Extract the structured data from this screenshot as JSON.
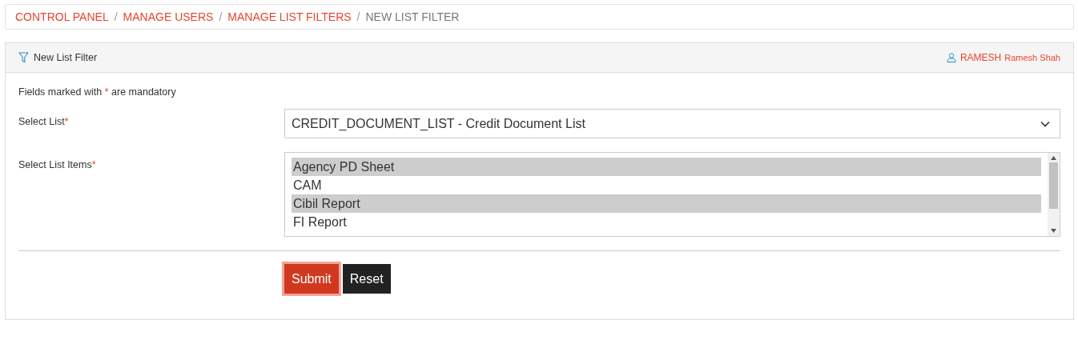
{
  "breadcrumb": [
    {
      "label": "CONTROL PANEL",
      "link": true
    },
    {
      "label": "MANAGE USERS",
      "link": true
    },
    {
      "label": "MANAGE LIST FILTERS",
      "link": true
    },
    {
      "label": "NEW LIST FILTER",
      "link": false
    }
  ],
  "breadcrumb_separator": "/",
  "panel": {
    "title": "New List Filter",
    "user_code": "RAMESH",
    "user_name": "Ramesh Shah"
  },
  "mandatory_note": {
    "before": "Fields marked with",
    "mark": "*",
    "after": "are mandatory"
  },
  "fields": [
    {
      "kind": "select",
      "label": "Select List",
      "required": true,
      "value": "CREDIT_DOCUMENT_LIST - Credit Document List"
    },
    {
      "kind": "listbox",
      "label": "Select List Items",
      "required": true,
      "options": [
        {
          "label": "Agency PD Sheet",
          "selected": true
        },
        {
          "label": "CAM",
          "selected": false
        },
        {
          "label": "Cibil Report",
          "selected": true
        },
        {
          "label": "FI Report",
          "selected": false
        }
      ]
    }
  ],
  "buttons": [
    {
      "kind": "primary",
      "label": "Submit"
    },
    {
      "kind": "dark",
      "label": "Reset"
    }
  ]
}
